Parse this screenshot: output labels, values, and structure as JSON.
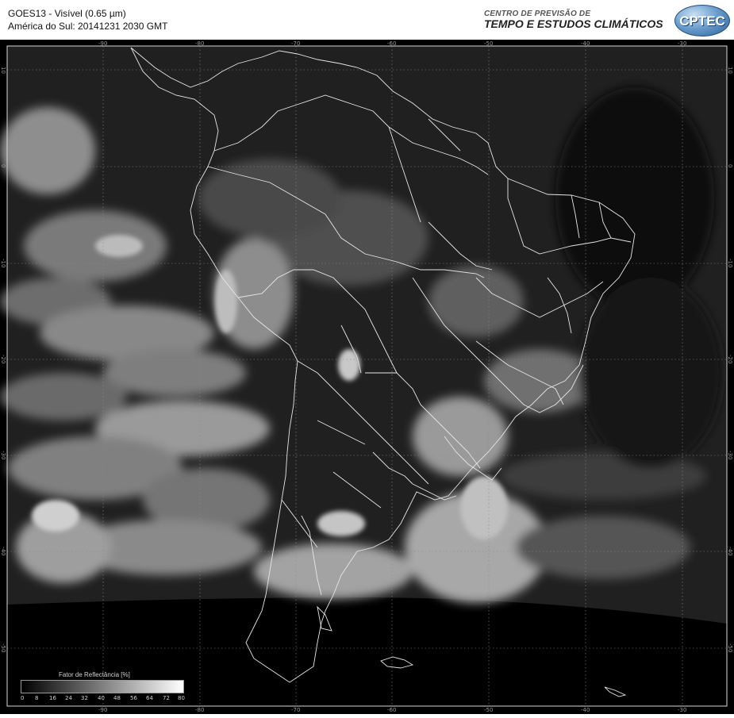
{
  "header": {
    "title": "GOES13 - Visível (0.65 µm)",
    "subtitle": "América do Sul: 20141231 2030 GMT",
    "org_small": "CENTRO DE PREVISÃO DE",
    "org_big": "TEMPO E ESTUDOS CLIMÁTICOS",
    "logo_text": "CPTEC"
  },
  "map": {
    "lon_ticks": [
      "-90",
      "-80",
      "-70",
      "-60",
      "-50",
      "-40",
      "-30"
    ],
    "lat_ticks": [
      "10",
      "0",
      "-10",
      "-20",
      "-30",
      "-40",
      "-50"
    ],
    "colors": {
      "background": "#000000",
      "grid": "#8a8a8a",
      "borders": "#e6e6e6",
      "cloud": "#d8d8d8"
    }
  },
  "legend": {
    "title": "Fator de Reflectância [%]",
    "labels": [
      "0",
      "8",
      "16",
      "24",
      "32",
      "40",
      "48",
      "56",
      "64",
      "72",
      "80"
    ]
  }
}
